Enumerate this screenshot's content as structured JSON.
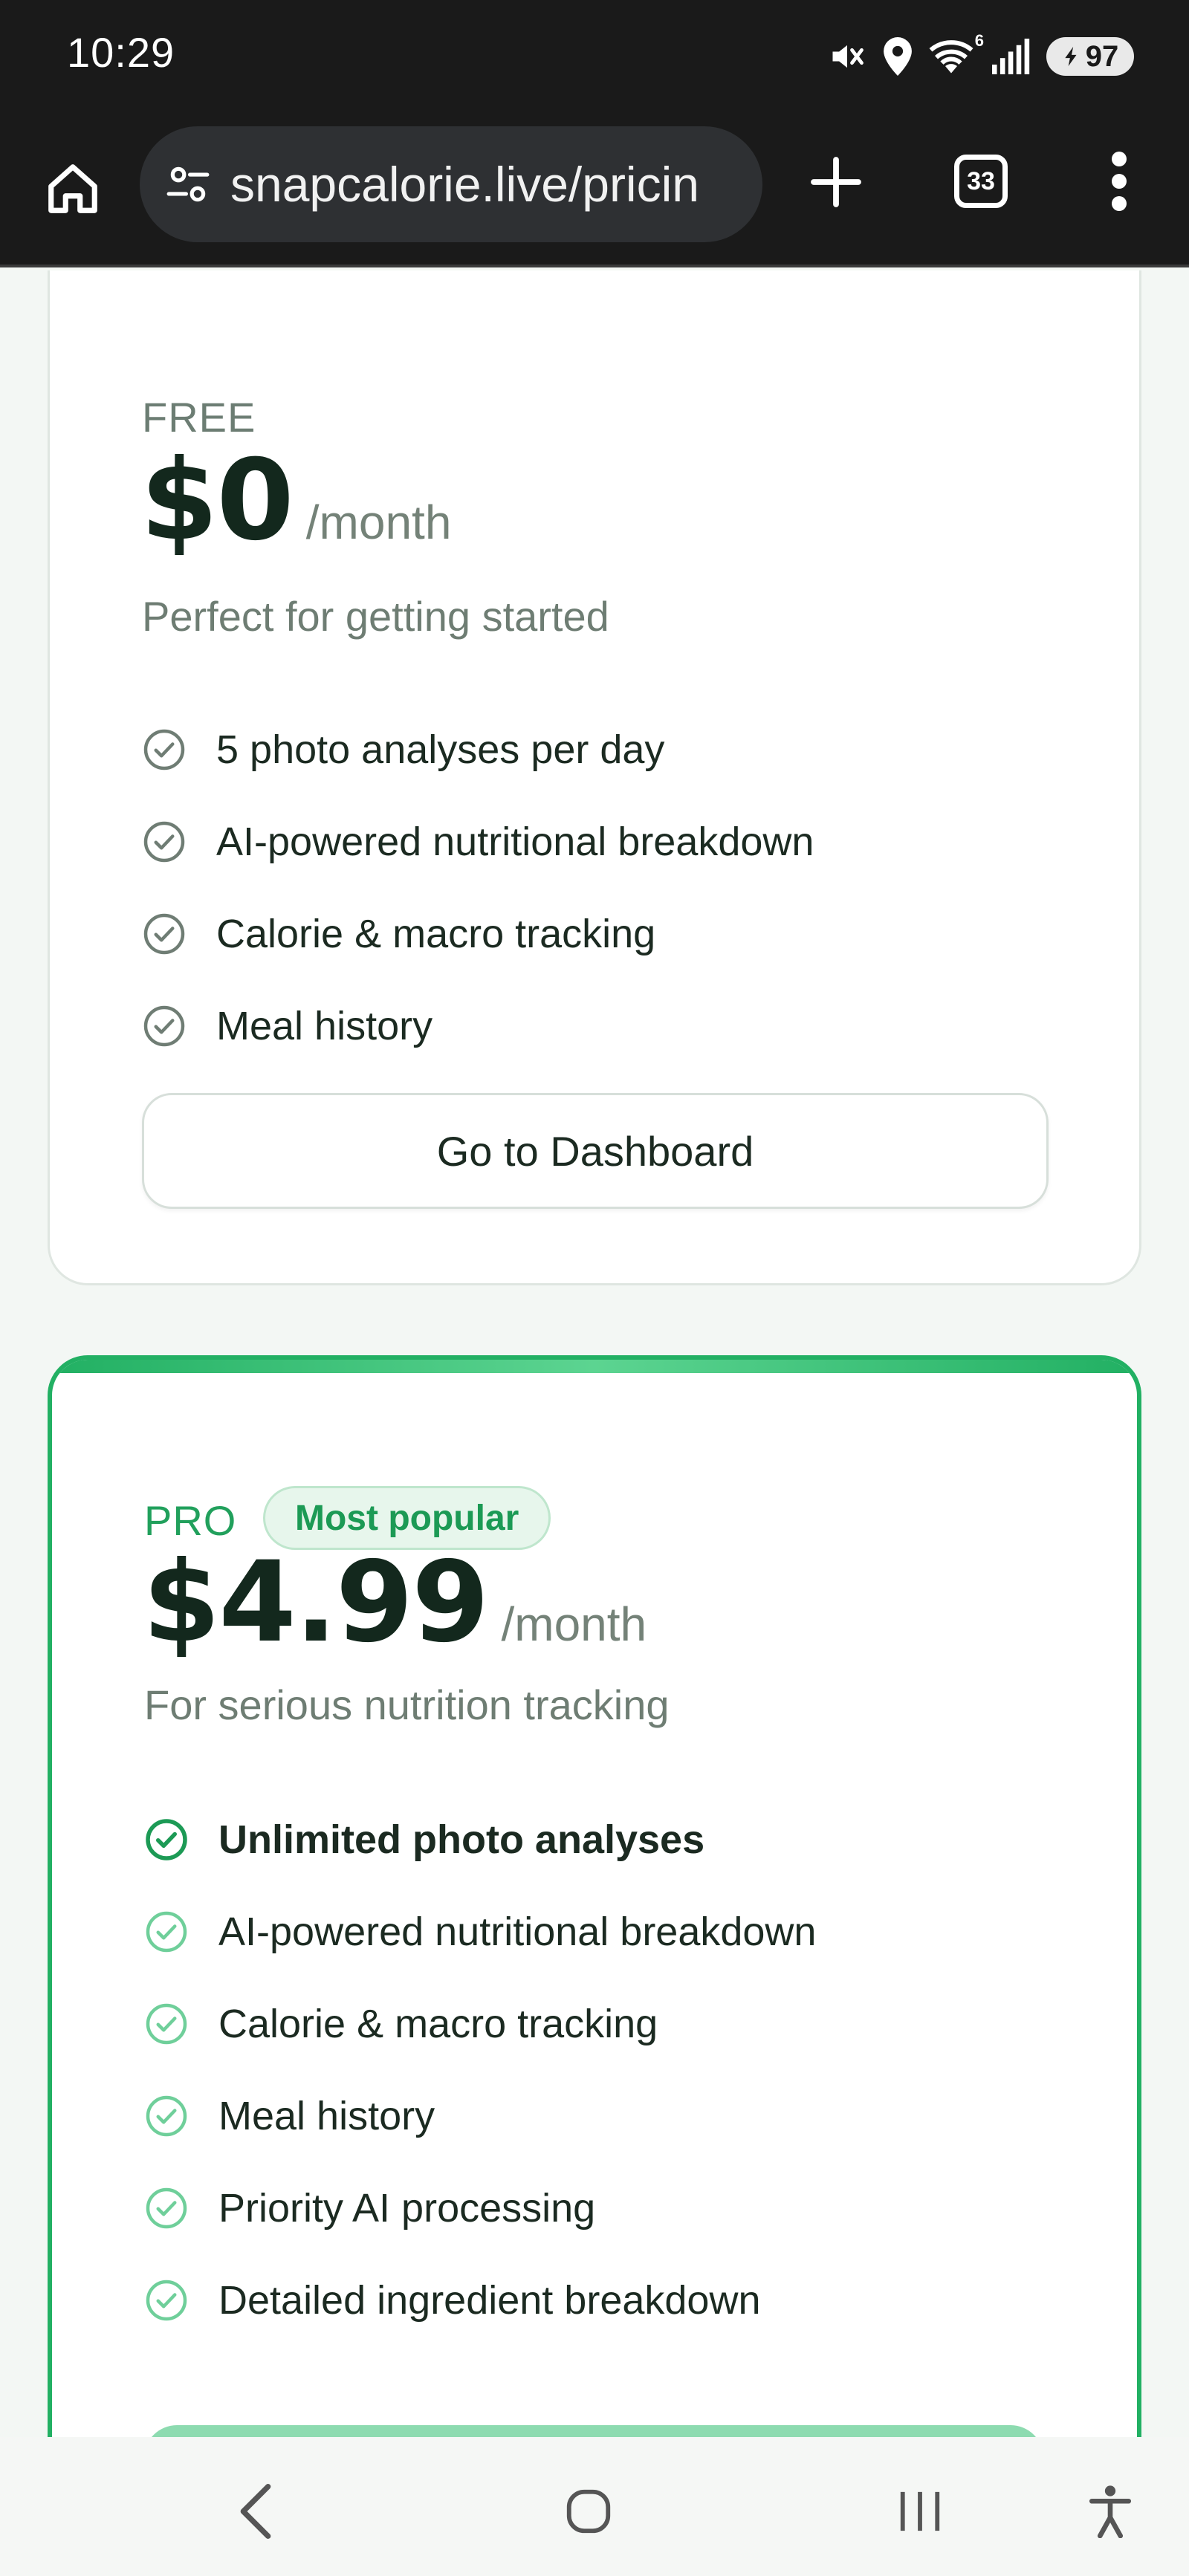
{
  "status_bar": {
    "time": "10:29",
    "icons": [
      "mute-icon",
      "location-icon",
      "wifi-icon",
      "signal-icon"
    ],
    "wifi_badge": "6",
    "battery": "97"
  },
  "browser": {
    "url": "snapcalorie.live/pricin",
    "tab_count": "33",
    "icons": [
      "home-icon",
      "site-settings-icon",
      "plus-icon",
      "tabs-icon",
      "more-vert-icon"
    ]
  },
  "plans": {
    "free": {
      "label": "FREE",
      "price": "$0",
      "per": "/month",
      "tagline": "Perfect for getting started",
      "features": [
        "5 photo analyses per day",
        "AI-powered nutritional breakdown",
        "Calorie & macro tracking",
        "Meal history"
      ],
      "button": "Go to Dashboard"
    },
    "pro": {
      "label": "PRO",
      "badge": "Most popular",
      "price": "$4.99",
      "per": "/month",
      "tagline": "For serious nutrition tracking",
      "features": [
        "Unlimited photo analyses",
        "AI-powered nutritional breakdown",
        "Calorie & macro tracking",
        "Meal history",
        "Priority AI processing",
        "Detailed ingredient breakdown"
      ]
    }
  },
  "colors": {
    "accent": "#22b063",
    "free_check": "#6f7d74",
    "pro_check_strong": "#1c9a55",
    "pro_check_light": "#6fcf9a"
  },
  "nav": {
    "icons": [
      "back-icon",
      "home-circle-icon",
      "recents-icon",
      "accessibility-icon"
    ]
  }
}
